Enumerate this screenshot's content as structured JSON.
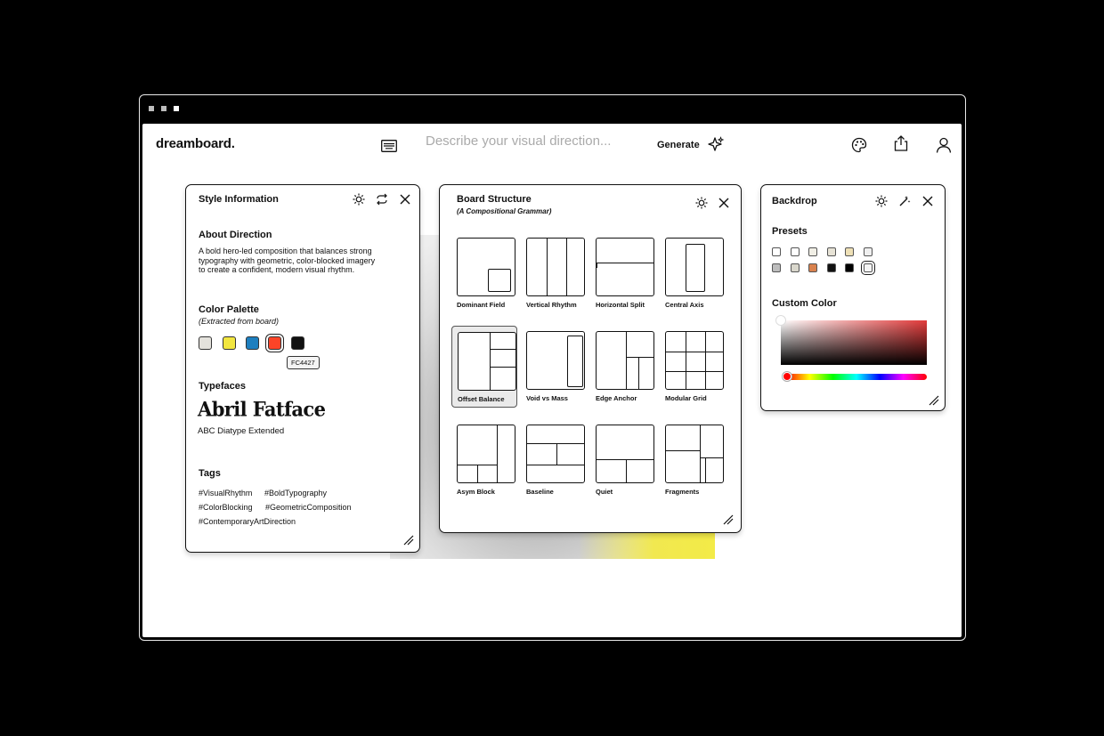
{
  "app": {
    "logo": "dreamboard.",
    "prompt_placeholder": "Describe your visual direction...",
    "generate_label": "Generate"
  },
  "style_panel": {
    "title": "Style Information",
    "about_heading": "About Direction",
    "about_lines": [
      "A bold hero-led composition that balances strong",
      "typography with geometric, color-blocked imagery",
      "to create a confident, modern visual rhythm."
    ],
    "palette_heading": "Color Palette",
    "palette_sub": "(Extracted from board)",
    "palette": [
      "#E4E2DC",
      "#F2E640",
      "#1E7FBF",
      "#FC4427",
      "#111111"
    ],
    "palette_selected_index": 3,
    "palette_tooltip": "FC4427",
    "typefaces_heading": "Typefaces",
    "typeface_primary": "Abril Fatface",
    "typeface_secondary": "ABC Diatype Extended",
    "tags_heading": "Tags",
    "tags": [
      "#VisualRhythm",
      "#BoldTypography",
      "#ColorBlocking",
      "#GeometricComposition",
      "#ContemporaryArtDirection"
    ]
  },
  "structure_panel": {
    "title": "Board Structure",
    "subtitle": "(A Compositional Grammar)",
    "layouts": [
      "Dominant Field",
      "Vertical Rhythm",
      "Horizontal Split",
      "Central Axis",
      "Offset Balance",
      "Void vs Mass",
      "Edge Anchor",
      "Modular Grid",
      "Asym Block",
      "Baseline",
      "Quiet",
      "Fragments"
    ],
    "selected_layout": "Offset Balance"
  },
  "backdrop_panel": {
    "title": "Backdrop",
    "presets_heading": "Presets",
    "presets": [
      "#ffffff",
      "#ffffff",
      "#f1efe6",
      "#e7e3d6",
      "#eee0b6",
      "#efefef",
      "#bdbdbd",
      "#d9d7cc",
      "#d9824e",
      "#111111",
      "#000000",
      "#f5f5f5"
    ],
    "preset_selected_index": 11,
    "custom_heading": "Custom Color",
    "custom_hue": "#FF0000"
  }
}
